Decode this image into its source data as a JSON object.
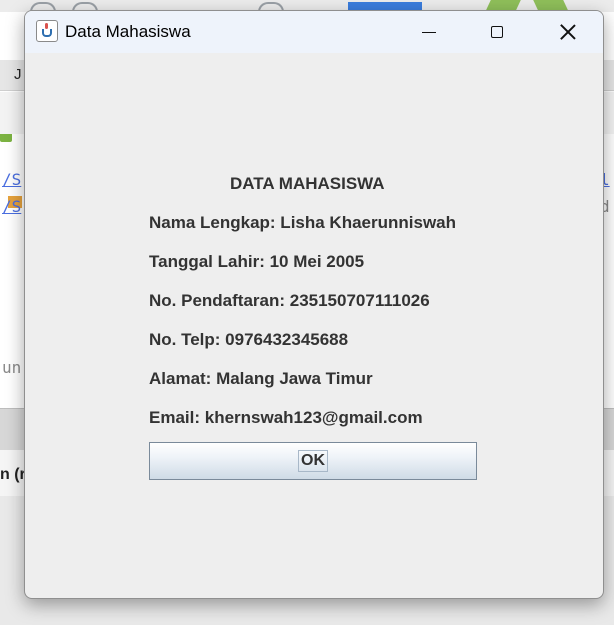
{
  "background": {
    "top_left_text": "J",
    "code_link_left": [
      "/S",
      "/S"
    ],
    "code_link_right": [
      "l",
      "d"
    ],
    "code_fragment": "un",
    "panel_text": "n (r"
  },
  "window": {
    "title": "Data Mahasiswa",
    "controls": {
      "minimize_icon": "minimize-icon",
      "maximize_icon": "maximize-icon",
      "close_icon": "close-icon"
    }
  },
  "content": {
    "heading": "DATA MAHASISWA",
    "lines": [
      "Nama Lengkap: Lisha Khaerunniswah",
      "Tanggal Lahir: 10 Mei 2005",
      "No. Pendaftaran: 235150707111026",
      "No. Telp: 0976432345688",
      "Alamat: Malang Jawa Timur",
      "Email: khernswah123@gmail.com"
    ],
    "ok_label": "OK"
  },
  "colors": {
    "window_bg": "#eeeeee",
    "titlebar_bg": "#eef3fb",
    "text": "#333333"
  }
}
